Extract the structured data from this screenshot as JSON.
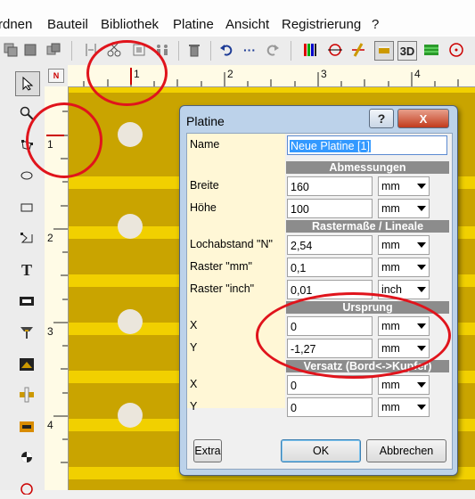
{
  "menubar": {
    "items": [
      "rdnen",
      "Bauteil",
      "Bibliothek",
      "Platine",
      "Ansicht",
      "Registrierung",
      "?"
    ]
  },
  "toolbar": {
    "icons": [
      "copy-icon",
      "paste-icon",
      "move-icon",
      "cut-icon",
      "mirror-icon",
      "group-icon",
      "delete-icon",
      "undo-icon",
      "dots-icon",
      "redo-icon",
      "layers-icon",
      "rotate-icon",
      "draw-icon",
      "view-2d-icon",
      "view-3d-icon",
      "grid-icon",
      "target-icon"
    ],
    "view3d_label": "3D"
  },
  "tools": {
    "items": [
      "select-arrow-icon",
      "zoom-icon",
      "polygon-icon",
      "ellipse-icon",
      "rectangle-icon",
      "poly-line-icon",
      "text-icon",
      "smd-pad-icon",
      "thru-pad-icon",
      "photo-icon",
      "connection-icon",
      "measure-icon",
      "circle-icon",
      "origin-icon"
    ],
    "text_tool": "T"
  },
  "ruler": {
    "corner_label": "N",
    "top": [
      "1",
      "2",
      "3",
      "4"
    ],
    "left": [
      "1",
      "2",
      "3",
      "4"
    ]
  },
  "dialog": {
    "title": "Platine",
    "help_button": "?",
    "close_button": "X",
    "name_label": "Name",
    "name_value": "Neue Platine [1]",
    "sections": {
      "abmessungen": "Abmessungen",
      "raster": "Rastermaße / Lineale",
      "ursprung": "Ursprung",
      "versatz": "Versatz (Bord<->Kupfer)"
    },
    "rows": {
      "breite": {
        "label": "Breite",
        "value": "160",
        "unit": "mm"
      },
      "hoehe": {
        "label": "Höhe",
        "value": "100",
        "unit": "mm"
      },
      "lochabstand": {
        "label": "Lochabstand \"N\"",
        "value": "2,54",
        "unit": "mm"
      },
      "raster_mm": {
        "label": "Raster \"mm\"",
        "value": "0,1",
        "unit": "mm"
      },
      "raster_inch": {
        "label": "Raster \"inch\"",
        "value": "0,01",
        "unit": "inch"
      },
      "ursprung_x": {
        "label": "X",
        "value": "0",
        "unit": "mm"
      },
      "ursprung_y": {
        "label": "Y",
        "value": "-1,27",
        "unit": "mm"
      },
      "versatz_x": {
        "label": "X",
        "value": "0",
        "unit": "mm"
      },
      "versatz_y": {
        "label": "Y",
        "value": "0",
        "unit": "mm"
      }
    },
    "buttons": {
      "extra": "Extra",
      "ok": "OK",
      "cancel": "Abbrechen"
    }
  },
  "colors": {
    "board": "#c9a400",
    "stripe": "#f1d000",
    "annotation": "#e0141c",
    "selection": "#3399ff"
  }
}
